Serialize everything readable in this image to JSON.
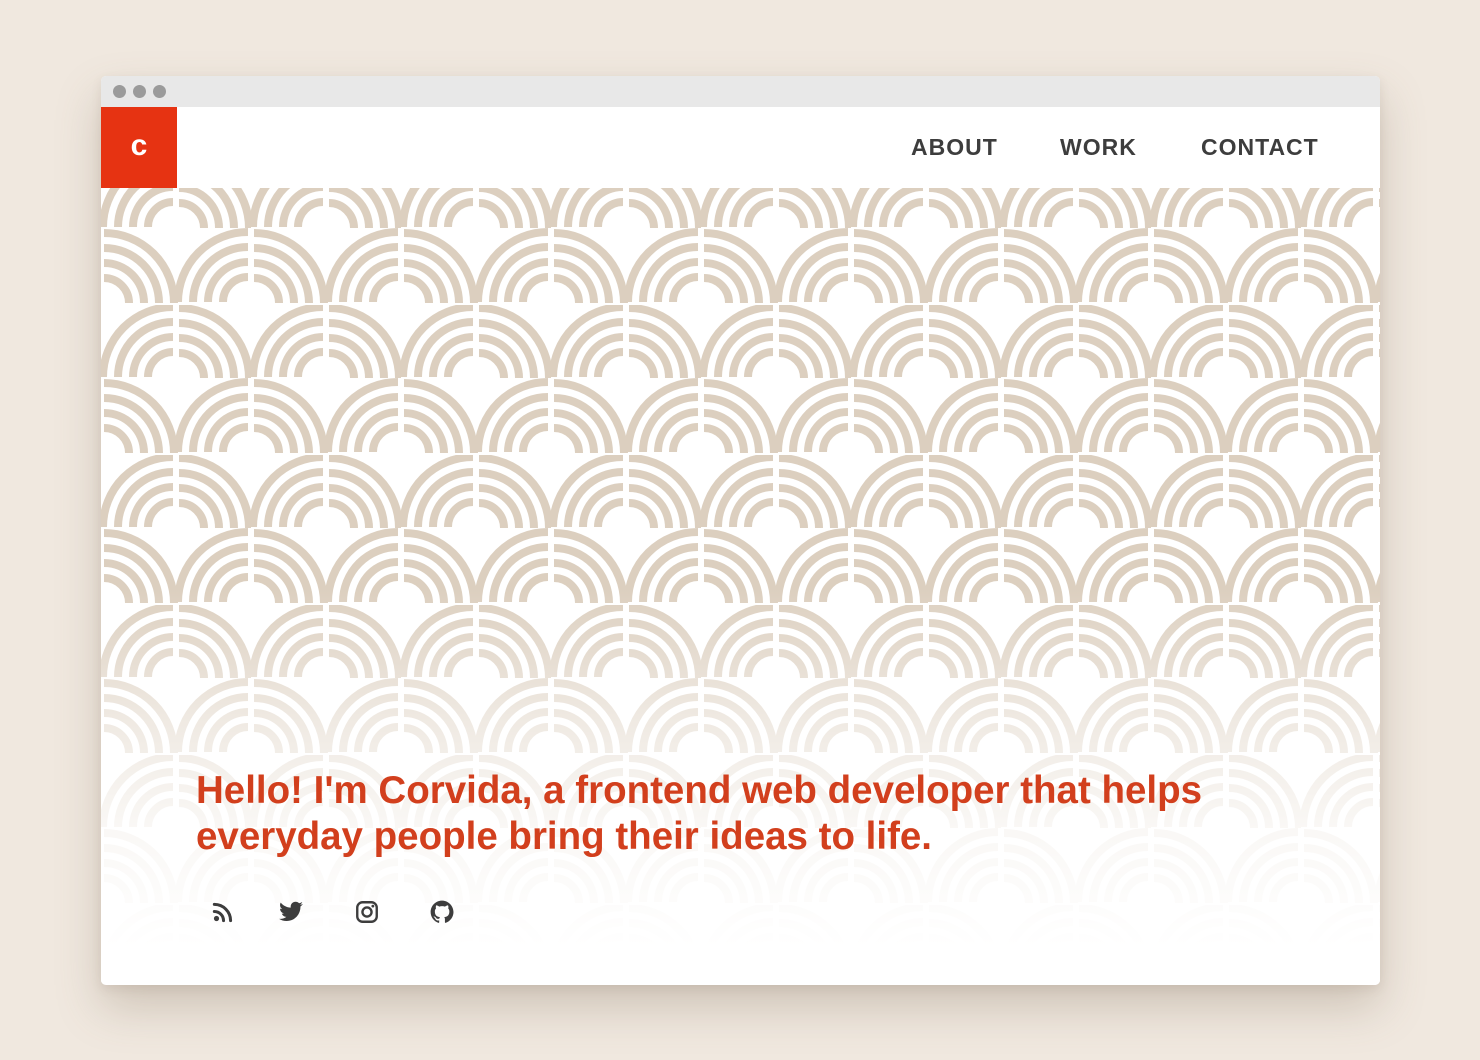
{
  "logo": {
    "letter": "c"
  },
  "nav": {
    "items": [
      {
        "label": "ABOUT"
      },
      {
        "label": "WORK"
      },
      {
        "label": "CONTACT"
      }
    ]
  },
  "hero": {
    "headline": "Hello! I'm Corvida, a frontend web developer that helps everyday people bring their ideas to life."
  },
  "socials": [
    {
      "icon": "rss-icon"
    },
    {
      "icon": "twitter-icon"
    },
    {
      "icon": "instagram-icon"
    },
    {
      "icon": "github-icon"
    }
  ],
  "colors": {
    "page_background": "#f0e8df",
    "accent": "#e63312",
    "headline": "#d23f1d",
    "pattern": "#dccfbf",
    "nav_text": "#3d3d3d",
    "icon": "#3d3d3d"
  }
}
